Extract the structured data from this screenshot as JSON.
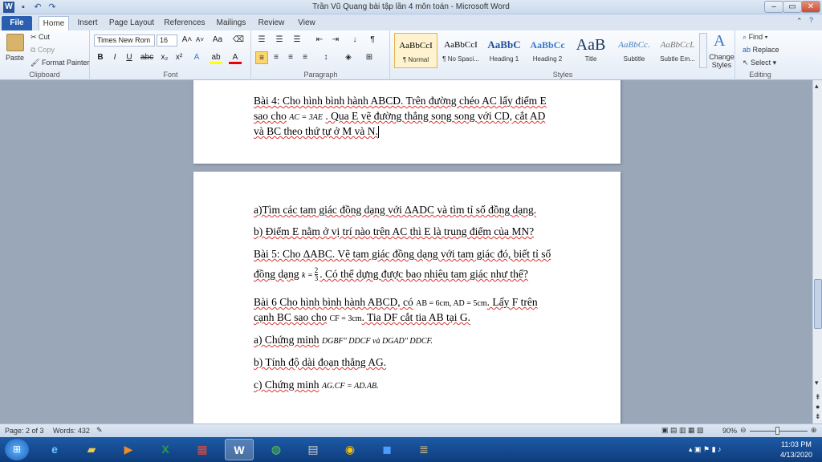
{
  "window": {
    "title": "Trần Vũ Quang bài tập lần 4 môn toán - Microsoft Word"
  },
  "tabs": [
    "File",
    "Home",
    "Insert",
    "Page Layout",
    "References",
    "Mailings",
    "Review",
    "View"
  ],
  "clipboard": {
    "paste": "Paste",
    "cut": "Cut",
    "copy": "Copy",
    "format_painter": "Format Painter",
    "label": "Clipboard"
  },
  "font": {
    "name": "Times New Rom",
    "size": "16",
    "label": "Font"
  },
  "paragraph": {
    "label": "Paragraph"
  },
  "styles": {
    "label": "Styles",
    "items": [
      {
        "preview": "AaBbCcI",
        "name": "¶ Normal"
      },
      {
        "preview": "AaBbCcI",
        "name": "¶ No Spaci..."
      },
      {
        "preview": "AaBbC",
        "name": "Heading 1"
      },
      {
        "preview": "AaBbCc",
        "name": "Heading 2"
      },
      {
        "preview": "AaB",
        "name": "Title"
      },
      {
        "preview": "AaBbCc.",
        "name": "Subtitle"
      },
      {
        "preview": "AaBbCcL",
        "name": "Subtle Em..."
      }
    ],
    "change": "Change Styles"
  },
  "editing": {
    "find": "Find",
    "replace": "Replace",
    "select": "Select",
    "label": "Editing"
  },
  "doc": {
    "page1": {
      "l1": "Bài 4: Cho hình bình hành ABCD. Trên đường chéo AC lấy điểm E",
      "l2a": "sao cho",
      "l2m": "AC = 3AE",
      "l2b": ". Qua E vẽ đường thẳng song song với CD, cắt AD",
      "l3": "và BC theo thứ tự ở M và N."
    },
    "page2": {
      "q1": "a)Tìm các tam giác đồng dạng với ∆ADC và tìm tỉ số đồng dạng.",
      "q2": "b) Điểm E nằm ở vị trí nào trên AC  thì E là trung điểm của MN?",
      "b5a": "Bài 5:  Cho ∆ABC. Vẽ tam giác đồng dạng với tam giác đó, biết tỉ số",
      "b5b": "đồng dạng",
      "b5k": "k =",
      "b5num": "2",
      "b5den": "3",
      "b5c": ". Có thể dựng được bao nhiêu tam giác như thế?",
      "b6a": "Bài 6  Cho hình bình hành ABCD, có",
      "b6m": "AB = 6cm, AD = 5cm",
      "b6b": ". Lấy F trên",
      "b6c": "cạnh BC sao cho",
      "b6m2": "CF = 3cm",
      "b6d": ". Tia DF cắt tia AB tại G.",
      "a6": "a) Chứng minh",
      "a6m": "DGBF\" DDCF  và DGAD\" DDCF.",
      "b6": "b) Tính độ dài đoạn thẳng AG.",
      "c6": "c) Chứng minh",
      "c6m": "AG.CF = AD.AB."
    }
  },
  "status": {
    "page": "Page: 2 of 3",
    "words": "Words: 432",
    "zoom": "90%"
  },
  "clock": {
    "time": "11:03 PM",
    "date": "4/13/2020"
  }
}
